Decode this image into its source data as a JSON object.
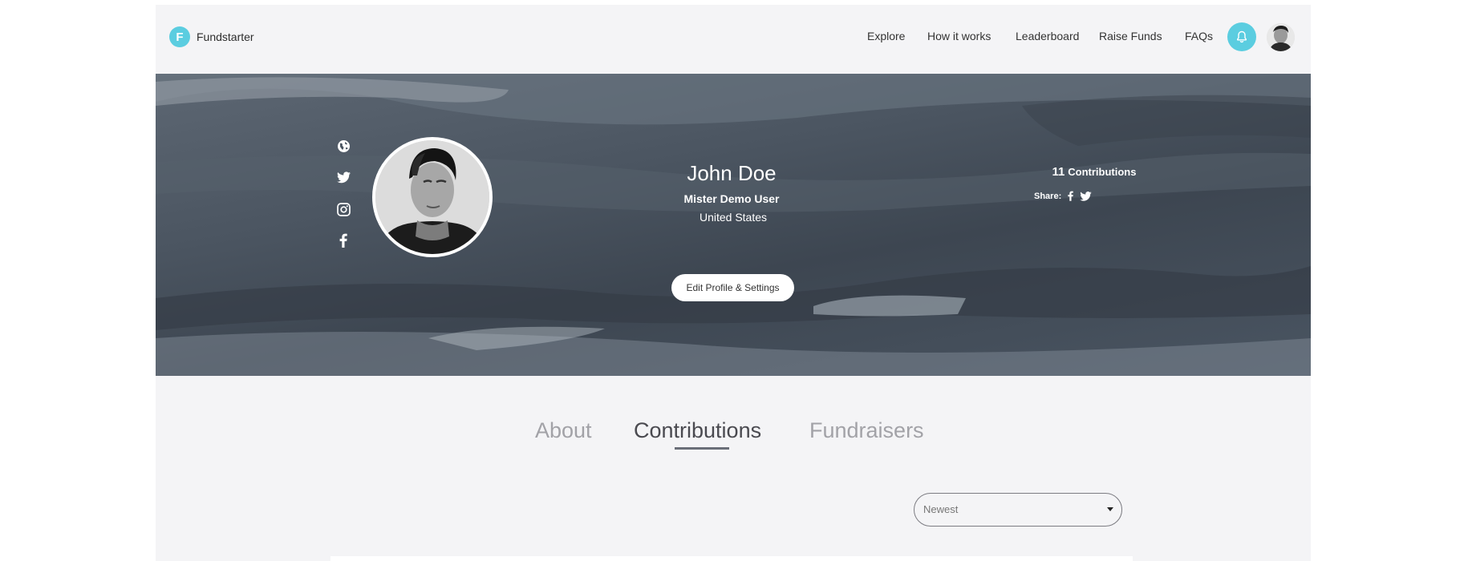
{
  "header": {
    "logo_letter": "F",
    "brand": "Fundstarter",
    "nav": [
      "Explore",
      "How it works",
      "Leaderboard",
      "Raise Funds",
      "FAQs"
    ],
    "accent_color": "#5bcde0",
    "icons": [
      "bell-icon",
      "user-avatar"
    ]
  },
  "profile": {
    "name": "John Doe",
    "subtitle": "Mister Demo User",
    "country": "United States",
    "edit_label": "Edit Profile & Settings",
    "contributions_count": "11",
    "contributions_label": "Contributions",
    "share_label": "Share:",
    "social_icons": [
      "globe-icon",
      "twitter-icon",
      "instagram-icon",
      "facebook-icon"
    ],
    "share_icons": [
      "facebook-icon",
      "twitter-icon"
    ]
  },
  "tabs": [
    {
      "label": "About",
      "active": false
    },
    {
      "label": "Contributions",
      "active": true
    },
    {
      "label": "Fundraisers",
      "active": false
    }
  ],
  "sort": {
    "selected": "Newest"
  }
}
